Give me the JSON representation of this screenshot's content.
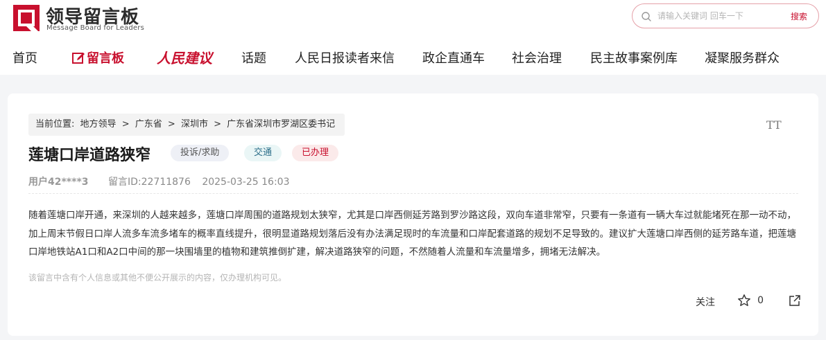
{
  "header": {
    "logo_title": "领导留言板",
    "logo_subtitle": "Message Board for Leaders",
    "search": {
      "placeholder": "请输入关键词 回车一下",
      "button": "搜索"
    }
  },
  "nav": {
    "items": [
      {
        "label": "首页"
      },
      {
        "label": "留言板"
      },
      {
        "label": "人民建议"
      },
      {
        "label": "话题"
      },
      {
        "label": "人民日报读者来信"
      },
      {
        "label": "政企直通车"
      },
      {
        "label": "社会治理"
      },
      {
        "label": "民主故事案例库"
      },
      {
        "label": "凝聚服务群众"
      }
    ]
  },
  "breadcrumb": {
    "prefix": "当前位置:",
    "items": [
      "地方领导",
      ">",
      "广东省",
      ">",
      "深圳市",
      ">",
      "广东省深圳市罗湖区委书记"
    ]
  },
  "font_toggle": "TT",
  "message": {
    "title": "莲塘口岸道路狭窄",
    "tags": [
      "投诉/求助",
      "交通",
      "已办理"
    ],
    "user": "用户42****3",
    "message_id": "留言ID:22711876",
    "datetime": "2025-03-25 16:03",
    "body": "随着莲塘口岸开通，来深圳的人越来越多，莲塘口岸周围的道路规划太狭窄，尤其是口岸西侧延芳路到罗沙路这段，双向车道非常窄，只要有一条道有一辆大车过就能堵死在那一动不动，加上周末节假日口岸人流多车流多堵车的概率直线提升，很明显道路规划落后没有办法满足现时的车流量和口岸配套道路的规划不足导致的。建议扩大莲塘口岸西侧的延芳路车道，把莲塘口岸地铁站A1口和A2口中间的那一块围墙里的植物和建筑推倒扩建，解决道路狭窄的问题，不然随着人流量和车流量增多，拥堵无法解决。",
    "notice": "该留言中含有个人信息或其他不便公开展示的内容，仅办理机构可见。"
  },
  "actions": {
    "follow": "关注",
    "star_count": "0"
  },
  "colors": {
    "brand_red": "#c8102e",
    "page_bg": "#f4f5f7"
  }
}
